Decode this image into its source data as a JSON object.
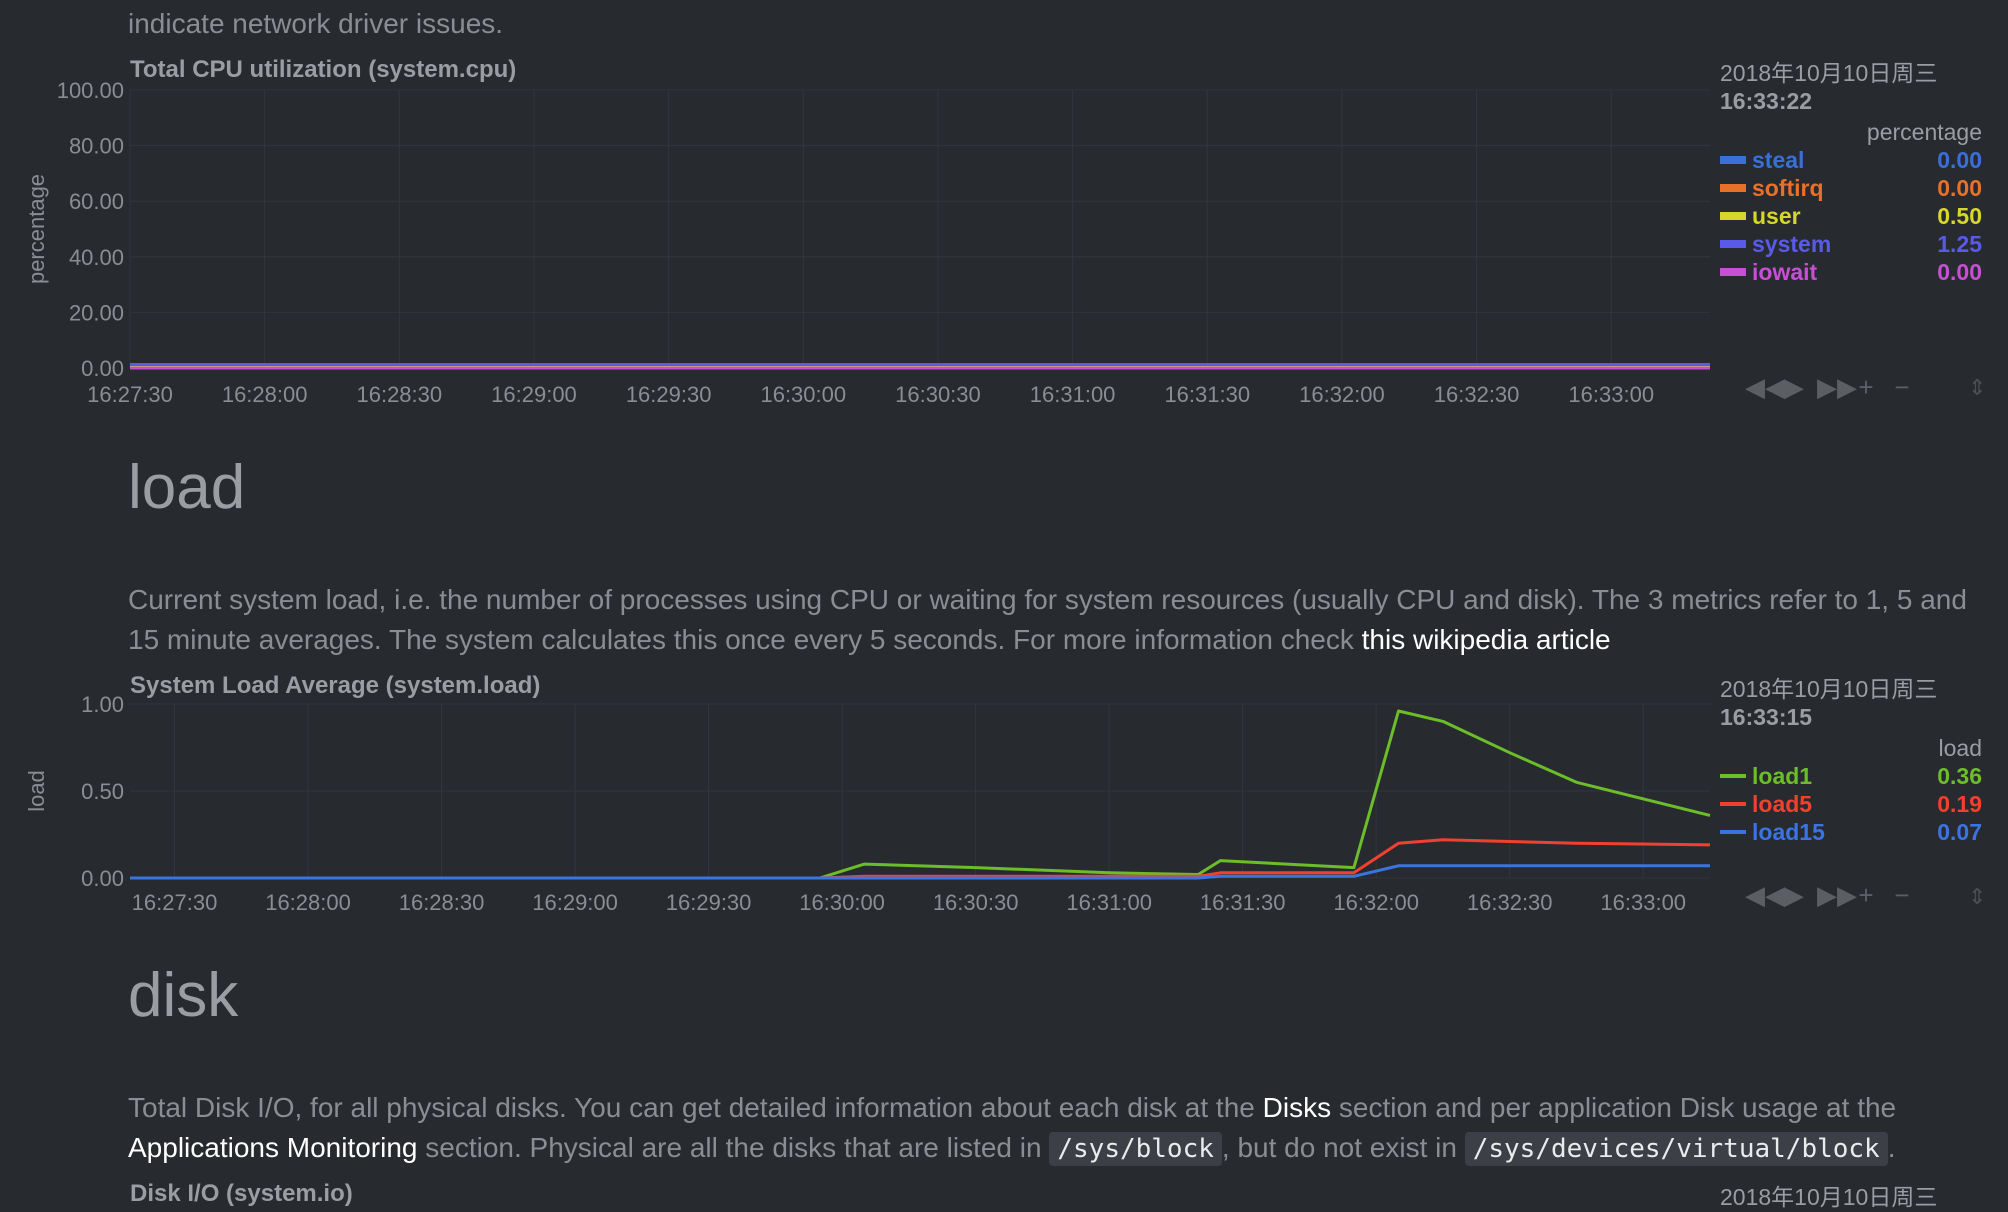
{
  "intro": "indicate network driver issues.",
  "cpu": {
    "title": "Total CPU utilization (system.cpu)",
    "ylabel": "percentage",
    "date": "2018年10月10日周三",
    "time": "16:33:22",
    "units": "percentage",
    "legend": [
      {
        "name": "steal",
        "value": "0.00",
        "color": "#3a6fd8"
      },
      {
        "name": "softirq",
        "value": "0.00",
        "color": "#e8712a"
      },
      {
        "name": "user",
        "value": "0.50",
        "color": "#d6d62b"
      },
      {
        "name": "system",
        "value": "1.25",
        "color": "#5a5ae8"
      },
      {
        "name": "iowait",
        "value": "0.00",
        "color": "#c64fd4"
      }
    ]
  },
  "load": {
    "heading": "load",
    "desc_text": "Current system load, i.e. the number of processes using CPU or waiting for system resources (usually CPU and disk). The 3 metrics refer to 1, 5 and 15 minute averages. The system calculates this once every 5 seconds. For more information check ",
    "desc_link": "this wikipedia article",
    "title": "System Load Average (system.load)",
    "ylabel": "load",
    "date": "2018年10月10日周三",
    "time": "16:33:15",
    "units": "load",
    "legend": [
      {
        "name": "load1",
        "value": "0.36",
        "color": "#6cbd2a"
      },
      {
        "name": "load5",
        "value": "0.19",
        "color": "#f2402f"
      },
      {
        "name": "load15",
        "value": "0.07",
        "color": "#3a74e0"
      }
    ]
  },
  "disk": {
    "heading": "disk",
    "desc_part1": "Total Disk I/O, for all physical disks. You can get detailed information about each disk at the ",
    "desc_link1": "Disks",
    "desc_part2": " section and per application Disk usage at the ",
    "desc_link2": "Applications Monitoring",
    "desc_part3": " section. Physical are all the disks that are listed in ",
    "code1": "/sys/block",
    "desc_part4": ", but do not exist in ",
    "code2": "/sys/devices/virtual/block",
    "desc_part5": ".",
    "title": "Disk I/O (system.io)",
    "date": "2018年10月10日周三"
  },
  "controls": {
    "rewind": "◀◀",
    "play": "▶",
    "forward": "▶▶",
    "zoom_in": "+",
    "zoom_out": "−",
    "resize": "⇕"
  },
  "chart_data": [
    {
      "type": "area",
      "title": "Total CPU utilization (system.cpu)",
      "ylabel": "percentage",
      "ylim": [
        0,
        100
      ],
      "yticks": [
        "100.00",
        "80.00",
        "60.00",
        "40.00",
        "20.00",
        "0.00"
      ],
      "xticks": [
        "16:27:30",
        "16:28:00",
        "16:28:30",
        "16:29:00",
        "16:29:30",
        "16:30:00",
        "16:30:30",
        "16:31:00",
        "16:31:30",
        "16:32:00",
        "16:32:30",
        "16:33:00"
      ],
      "x": [
        "16:27:30",
        "16:33:22"
      ],
      "series": [
        {
          "name": "steal",
          "values": [
            0.0,
            0.0
          ]
        },
        {
          "name": "softirq",
          "values": [
            0.0,
            0.0
          ]
        },
        {
          "name": "user",
          "values": [
            0.5,
            0.5
          ]
        },
        {
          "name": "system",
          "values": [
            1.25,
            1.25
          ]
        },
        {
          "name": "iowait",
          "values": [
            0.0,
            0.0
          ]
        }
      ],
      "grid": true
    },
    {
      "type": "line",
      "title": "System Load Average (system.load)",
      "ylabel": "load",
      "ylim": [
        0,
        1
      ],
      "yticks": [
        "1.00",
        "0.50",
        "0.00"
      ],
      "xticks": [
        "16:27:30",
        "16:28:00",
        "16:28:30",
        "16:29:00",
        "16:29:30",
        "16:30:00",
        "16:30:30",
        "16:31:00",
        "16:31:30",
        "16:32:00",
        "16:32:30",
        "16:33:00"
      ],
      "x": [
        "16:27:20",
        "16:29:55",
        "16:30:05",
        "16:30:30",
        "16:31:00",
        "16:31:20",
        "16:31:25",
        "16:31:55",
        "16:32:05",
        "16:32:15",
        "16:32:30",
        "16:32:45",
        "16:33:15"
      ],
      "series": [
        {
          "name": "load1",
          "values": [
            0.0,
            0.0,
            0.08,
            0.06,
            0.03,
            0.02,
            0.1,
            0.06,
            0.96,
            0.9,
            0.72,
            0.55,
            0.36
          ]
        },
        {
          "name": "load5",
          "values": [
            0.0,
            0.0,
            0.01,
            0.01,
            0.01,
            0.01,
            0.03,
            0.03,
            0.2,
            0.22,
            0.21,
            0.2,
            0.19
          ]
        },
        {
          "name": "load15",
          "values": [
            0.0,
            0.0,
            0.0,
            0.0,
            0.0,
            0.0,
            0.01,
            0.01,
            0.07,
            0.07,
            0.07,
            0.07,
            0.07
          ]
        }
      ],
      "grid": true
    }
  ]
}
